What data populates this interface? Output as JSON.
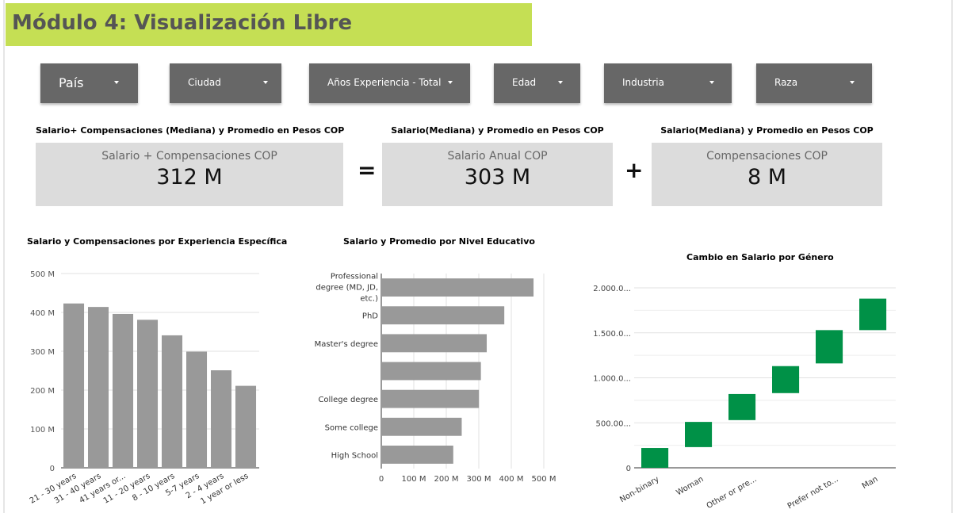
{
  "header": {
    "title": "Módulo 4: Visualización Libre",
    "accent_color": "#c5df54"
  },
  "filters": [
    {
      "label": "País"
    },
    {
      "label": "Ciudad"
    },
    {
      "label": "Años Experiencia - Total"
    },
    {
      "label": "Edad"
    },
    {
      "label": "Industria"
    },
    {
      "label": "Raza"
    }
  ],
  "kpis": [
    {
      "title": "Salario+ Compensaciones (Mediana) y Promedio en Pesos COP",
      "label": "Salario + Compensaciones COP",
      "value": "312 M"
    },
    {
      "title": "Salario(Mediana) y Promedio en Pesos COP",
      "label": "Salario Anual COP",
      "value": "303 M"
    },
    {
      "title": "Salario(Mediana) y Promedio en Pesos COP",
      "label": "Compensaciones COP",
      "value": "8 M"
    }
  ],
  "operators": {
    "equals": "=",
    "plus": "+"
  },
  "chart_data": [
    {
      "type": "bar",
      "title": "Salario y Compensaciones por Experiencia Específica",
      "categories": [
        "21 - 30 years",
        "31 - 40 years",
        "41 years or...",
        "11 - 20 years",
        "8 - 10 years",
        "5-7 years",
        "2 - 4 years",
        "1 year or less"
      ],
      "values": [
        423,
        414,
        396,
        381,
        341,
        299,
        251,
        211
      ],
      "yticks": [
        "0",
        "100 M",
        "200 M",
        "300 M",
        "400 M",
        "500 M"
      ],
      "ylim": [
        0,
        500
      ],
      "unit": "M",
      "color": "#999999",
      "grid": true
    },
    {
      "type": "bar",
      "orientation": "horizontal",
      "title": "Salario y Promedio por Nivel Educativo",
      "categories": [
        "Professional degree (MD, JD, etc.)",
        "PhD",
        "Master's degree",
        "",
        "College degree",
        "Some college",
        "High School"
      ],
      "values": [
        466,
        376,
        322,
        304,
        298,
        245,
        219
      ],
      "xticks": [
        "0",
        "100 M",
        "200 M",
        "300 M",
        "400 M",
        "500 M"
      ],
      "xlim": [
        0,
        500
      ],
      "unit": "M",
      "color": "#999999",
      "grid": true
    },
    {
      "type": "waterfall",
      "title": "Cambio en Salario por Género",
      "categories": [
        "Non-binary",
        "Woman",
        "Other or pre...",
        "Prefer not to...",
        "Man"
      ],
      "bars": [
        {
          "start": 0,
          "end": 220
        },
        {
          "start": 230,
          "end": 510
        },
        {
          "start": 530,
          "end": 820
        },
        {
          "start": 830,
          "end": 1130
        },
        {
          "start": 1160,
          "end": 1530
        },
        {
          "start": 1530,
          "end": 1880
        }
      ],
      "yticks": [
        "0",
        "500.00...",
        "1.000.0...",
        "1.500.0...",
        "2.000.0..."
      ],
      "ylim": [
        0,
        2000
      ],
      "color": "#009147",
      "grid": true
    }
  ]
}
